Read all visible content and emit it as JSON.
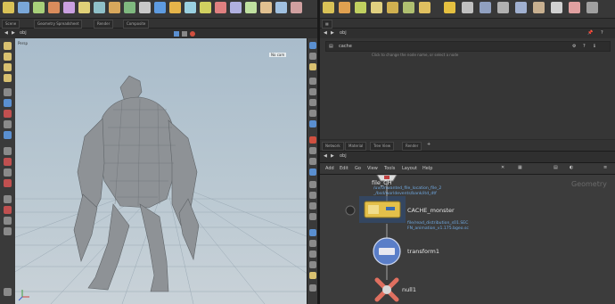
{
  "pane_tabs": [
    "Scene",
    "Geometry Spreadsheet",
    "Render",
    "Composite"
  ],
  "viewport": {
    "path": "obj",
    "label": "Persp",
    "camera_menu": "No cam"
  },
  "parameters": {
    "node": "cache",
    "message": "Click to change the node name, or select a node"
  },
  "network": {
    "tabs": [
      "Network",
      "Material",
      "Tree View",
      "Render"
    ],
    "path": "obj",
    "menu": [
      "Add",
      "Edit",
      "Go",
      "View",
      "Tools",
      "Layout",
      "Help"
    ],
    "context_label": "Geometry",
    "nodes": [
      {
        "name": "file_CH",
        "info_label": "",
        "info_lines": [
          "/uv/Unwanted_file_location_file_2",
          "_/bsd/worldevents/bank/itd_dtf"
        ]
      },
      {
        "name": "CACHE_monster",
        "info_label": "",
        "info_lines": [
          "file/read_distribution_s01.SEC",
          "FN_animation_v1.175.bgeo.sc"
        ]
      },
      {
        "name": "transform1"
      },
      {
        "name": "null1"
      }
    ]
  },
  "colors": {
    "accent_blue": "#3c6aa8",
    "node_file": "#dcdcdc",
    "node_cache": "#e4c04a",
    "node_xform": "#5a7ec8",
    "node_null": "#d8d8d8",
    "sky": "#b8c7d1"
  }
}
